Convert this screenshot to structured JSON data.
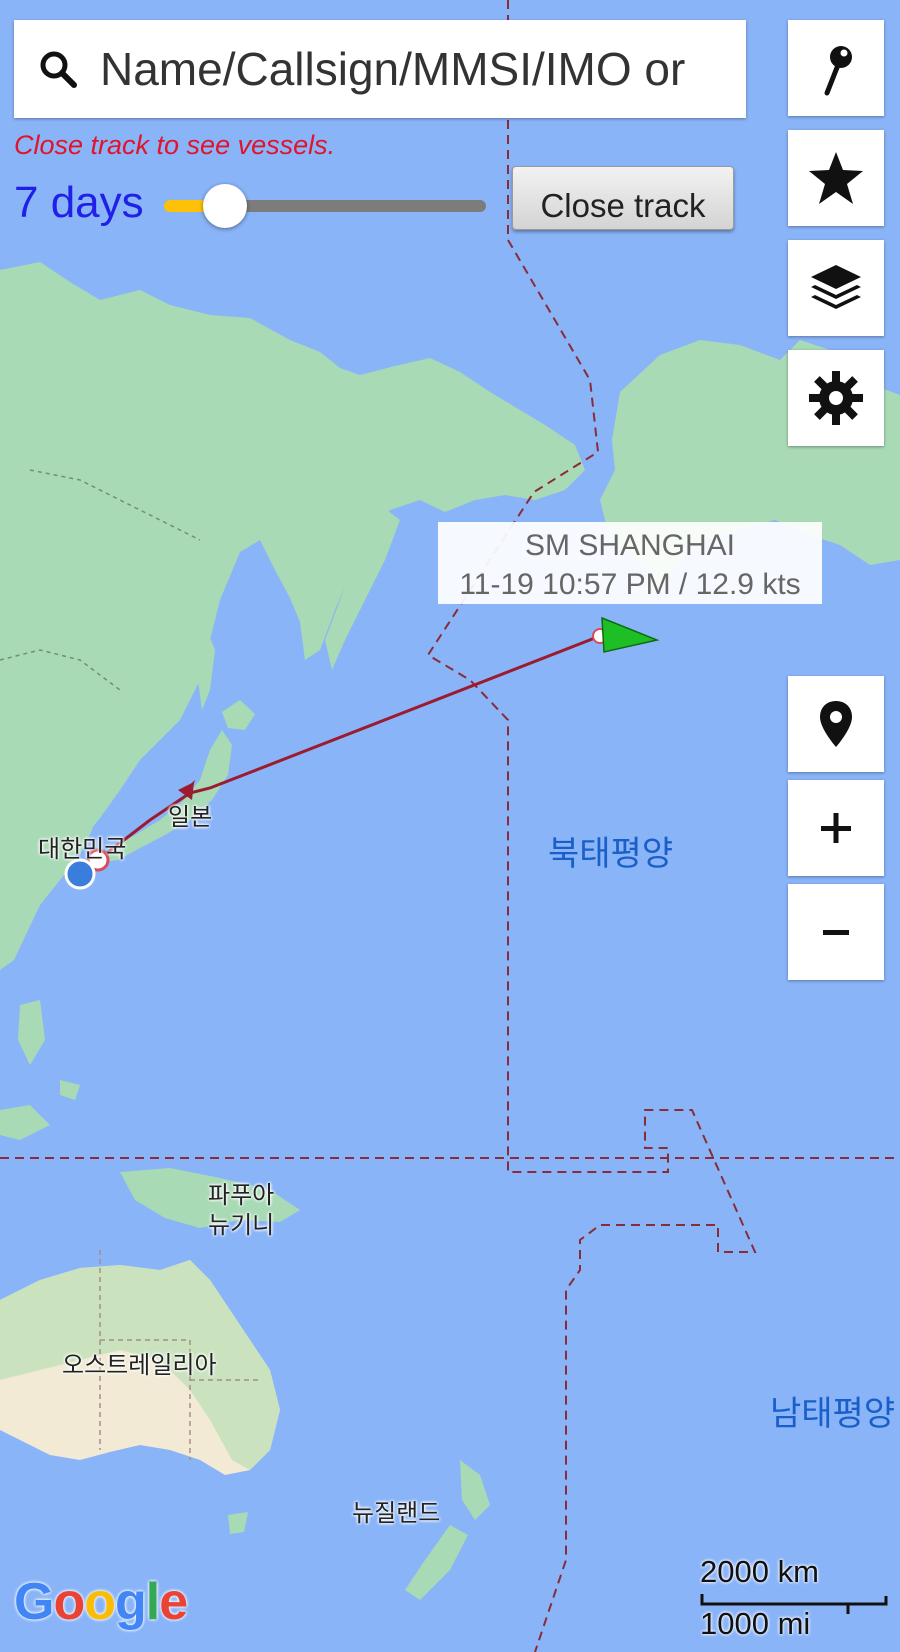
{
  "search": {
    "placeholder": "Name/Callsign/MMSI/IMO or"
  },
  "hint_text": "Close track to see vessels.",
  "track": {
    "days_label": "7 days",
    "slider_fraction": 0.19,
    "close_label": "Close track"
  },
  "toolbar_icons": [
    "pin-icon",
    "star-icon",
    "layers-icon",
    "gear-icon"
  ],
  "map_controls": [
    "location-pin-icon",
    "zoom-in-icon",
    "zoom-out-icon"
  ],
  "vessel": {
    "name": "SM SHANGHAI",
    "status": "11-19 10:57 PM / 12.9 kts"
  },
  "places": {
    "japan": "일본",
    "korea": "대한민국",
    "png": [
      "파푸아",
      "뉴기니"
    ],
    "australia": "오스트레일리아",
    "nz": "뉴질랜드",
    "north_pacific": "북태평양",
    "south_pacific": "남태평양"
  },
  "zoom_in": "+",
  "zoom_out": "−",
  "scale": {
    "km": "2000 km",
    "mi": "1000 mi"
  },
  "google": "Google",
  "colors": {
    "ocean": "#8ab4f8",
    "land": "#a8dab5",
    "track": "#9b1b30",
    "vessel": "#1dbf24",
    "hint": "#e0142b",
    "days": "#2020e8"
  }
}
